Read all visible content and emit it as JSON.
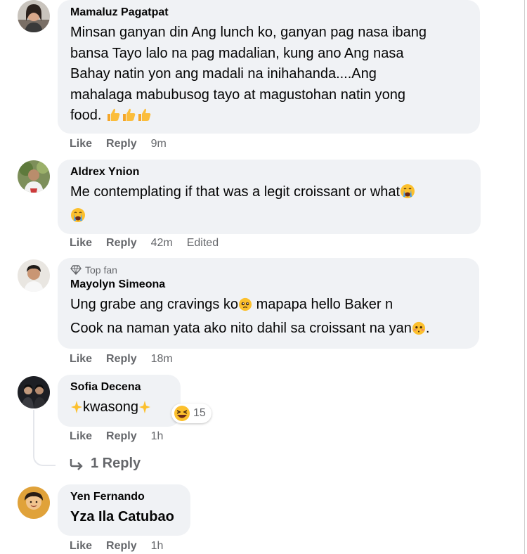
{
  "colors": {
    "bubble": "#f0f2f5",
    "meta_text": "#65676b",
    "body_text": "#050505"
  },
  "comments": [
    {
      "author": "Mamaluz Pagatpat",
      "lines": [
        "Minsan ganyan din Ang lunch ko, ganyan pag nasa ibang",
        "bansa Tayo lalo na pag madalian, kung ano Ang nasa",
        "Bahay natin yon ang madali na inihahanda....Ang",
        "mahalaga mabubusog tayo at magustohan natin yong",
        "food."
      ],
      "trailing_emoji": "thumbs-up-icon x3",
      "like": "Like",
      "reply": "Reply",
      "time": "9m"
    },
    {
      "author": "Aldrex Ynion",
      "lines": [
        "Me contemplating if that was a legit croissant or what"
      ],
      "trailing_emoji": "crying-face-icon x2",
      "like": "Like",
      "reply": "Reply",
      "time": "42m",
      "edited": "Edited"
    },
    {
      "badge": "Top fan",
      "author": "Mayolyn Simeona",
      "lines": [
        "Ung grabe ang cravings ko",
        "mapapa hello Baker n",
        "Cook na naman yata ako nito dahil sa croissant na yan",
        "."
      ],
      "like": "Like",
      "reply": "Reply",
      "time": "18m"
    },
    {
      "author": "Sofia Decena",
      "text": "kwasong",
      "reaction_count": "15",
      "like": "Like",
      "reply": "Reply",
      "time": "1h",
      "replies_link": "1 Reply"
    },
    {
      "author": "Yen Fernando",
      "text": "Yza Ila Catubao",
      "like": "Like",
      "reply": "Reply",
      "time": "1h"
    }
  ]
}
